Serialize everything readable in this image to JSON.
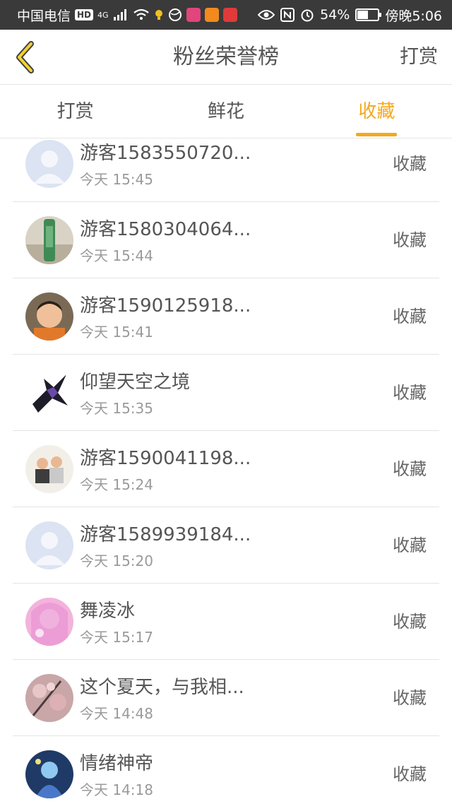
{
  "status_bar": {
    "carrier": "中国电信",
    "hd": "HD",
    "network": "4G",
    "battery_percent": "54%",
    "battery_level": 0.54,
    "time": "傍晚5:06"
  },
  "header": {
    "title": "粉丝荣誉榜",
    "action_label": "打赏"
  },
  "tabs": [
    {
      "label": "打赏"
    },
    {
      "label": "鲜花"
    },
    {
      "label": "收藏"
    }
  ],
  "active_tab_index": 2,
  "accent_color": "#f4a81e",
  "items": [
    {
      "name": "游客1583550720...",
      "time": "今天 15:45",
      "type": "收藏",
      "avatar": "default-avatar"
    },
    {
      "name": "游客1580304064...",
      "time": "今天 15:44",
      "type": "收藏",
      "avatar": "photo-avatar"
    },
    {
      "name": "游客1590125918...",
      "time": "今天 15:41",
      "type": "收藏",
      "avatar": "child-photo-avatar"
    },
    {
      "name": "仰望天空之境",
      "time": "今天 15:35",
      "type": "收藏",
      "avatar": "anime-figure-avatar"
    },
    {
      "name": "游客1590041198...",
      "time": "今天 15:24",
      "type": "收藏",
      "avatar": "children-photo-avatar"
    },
    {
      "name": "游客1589939184...",
      "time": "今天 15:20",
      "type": "收藏",
      "avatar": "default-avatar"
    },
    {
      "name": "舞凌冰",
      "time": "今天 15:17",
      "type": "收藏",
      "avatar": "pink-anime-avatar"
    },
    {
      "name": "这个夏天，与我相...",
      "time": "今天 14:48",
      "type": "收藏",
      "avatar": "blossom-photo-avatar"
    },
    {
      "name": "情绪神帝",
      "time": "今天 14:18",
      "type": "收藏",
      "avatar": "fantasy-art-avatar"
    }
  ]
}
